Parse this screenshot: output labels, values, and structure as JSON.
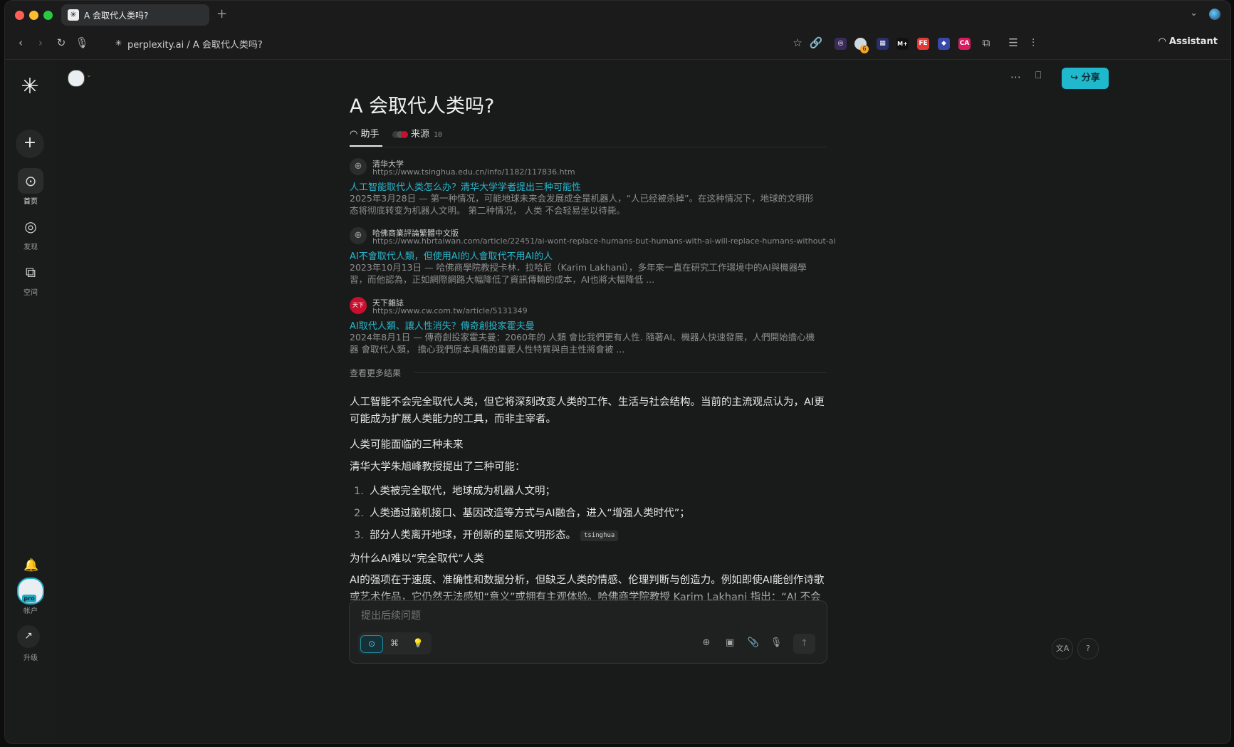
{
  "browser": {
    "tab_title": "A 会取代人类吗?",
    "new_tab": "+",
    "url": "perplexity.ai / A 会取代人类吗?",
    "extension_badge": "6",
    "extensions": [
      "FE",
      "CA"
    ],
    "assistant_label": "Assistant"
  },
  "sidebar": {
    "items": [
      {
        "label": "首页"
      },
      {
        "label": "发现"
      },
      {
        "label": "空间"
      }
    ],
    "pro_badge": "pro",
    "account_label": "帐户",
    "upgrade_label": "升级"
  },
  "header": {
    "share_label": "分享"
  },
  "question": {
    "title": "A 会取代人类吗?"
  },
  "tabs": {
    "assistant": "助手",
    "sources": "来源",
    "sources_count": "10"
  },
  "results": [
    {
      "site": "清华大学",
      "url": "https://www.tsinghua.edu.cn/info/1182/117836.htm",
      "title": "人工智能取代人类怎么办？清华大学学者提出三种可能性",
      "snippet": "2025年3月28日 — 第一种情况，可能地球未来会发展成全是机器人，“人已经被杀掉”。在这种情况下，地球的文明形态将彻底转变为机器人文明。 第二种情况， 人类 不会轻易坐以待毙。"
    },
    {
      "site": "哈佛商業評論繁體中文版",
      "url": "https://www.hbrtaiwan.com/article/22451/ai-wont-replace-humans-but-humans-with-ai-will-replace-humans-without-ai",
      "title": "AI不會取代人類，但使用AI的人會取代不用AI的人",
      "snippet": "2023年10月13日 — 哈佛商學院教授卡林．拉哈尼（Karim Lakhani），多年來一直在研究工作環境中的AI與機器學習，而他認為，正如網際網路大幅降低了資訊傳輸的成本，AI也將大幅降低 ..."
    },
    {
      "site": "天下雜誌",
      "url": "https://www.cw.com.tw/article/5131349",
      "title": "AI取代人類、讓人性消失？傳奇創投家霍夫曼",
      "snippet": "2024年8月1日 — 傳奇創投家霍夫曼：2060年的 人類 會比我們更有人性. 隨著AI、機器人快速發展，人們開始擔心機器 會取代人類， 擔心我們原本具備的重要人性特質與自主性將會被 ..."
    }
  ],
  "more_results": "查看更多结果",
  "answer": {
    "intro": "人工智能不会完全取代人类，但它将深刻改变人类的工作、生活与社会结构。当前的主流观点认为，AI更可能成为扩展人类能力的工具，而非主宰者。",
    "heading1": "人类可能面临的三种未来",
    "lead1": "清华大学朱旭峰教授提出了三种可能：",
    "list": [
      {
        "num": "1.",
        "text": "人类被完全取代，地球成为机器人文明；"
      },
      {
        "num": "2.",
        "text": "人类通过脑机接口、基因改造等方式与AI融合，进入“增强人类时代”；"
      },
      {
        "num": "3.",
        "text": "部分人类离开地球，开创新的星际文明形态。"
      }
    ],
    "citation": "tsinghua",
    "heading2": "为什么AI难以“完全取代”人类",
    "para2": "AI的强项在于速度、准确性和数据分析，但缺乏人类的情感、伦理判断与创造力。例如即使AI能创作诗歌或艺术作品，它仍然无法感知“意义”或拥有主观体验。哈佛商学院教授 Karim Lakhani 指出：“AI 不会"
  },
  "followup": {
    "placeholder": "提出后续问题"
  },
  "colors": {
    "accent": "#1fb8cd",
    "link": "#27b7cc",
    "background": "#191a1a"
  },
  "icons": {
    "logo": "perplexity-logo-icon",
    "search": "search-icon",
    "discover": "globe-icon",
    "spaces": "spaces-icon"
  }
}
